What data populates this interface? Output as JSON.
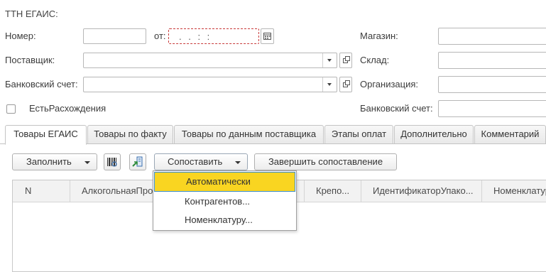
{
  "form": {
    "title": "ТТН ЕГАИС:"
  },
  "header": {
    "number_label": "Номер:",
    "number_value": "",
    "from_label": "от:",
    "date_value": ". .   : :",
    "supplier_label": "Поставщик:",
    "supplier_value": "",
    "bank_account_label": "Банковский счет:",
    "bank_account_value": "",
    "discrepancies_label": "ЕстьРасхождения",
    "store_label": "Магазин:",
    "warehouse_label": "Склад:",
    "organization_label": "Организация:",
    "org_bank_account_label": "Банковский счет:"
  },
  "tabs": [
    {
      "label": "Товары ЕГАИС"
    },
    {
      "label": "Товары по факту"
    },
    {
      "label": "Товары по данным поставщика"
    },
    {
      "label": "Этапы оплат"
    },
    {
      "label": "Дополнительно"
    },
    {
      "label": "Комментарий"
    }
  ],
  "toolbar": {
    "fill_label": "Заполнить",
    "match_label": "Сопоставить",
    "finish_match_label": "Завершить сопоставление",
    "barcode_icon": "barcode-icon",
    "import_icon": "import-icon"
  },
  "table": {
    "columns": [
      "N",
      "АлкогольнаяПро",
      "Крепо...",
      "ИдентификаторУпако...",
      "Номенклатура"
    ]
  },
  "match_menu": {
    "items": [
      "Автоматически",
      "Контрагентов...",
      "Номенклатуру..."
    ]
  },
  "colors": {
    "highlight": "#f9d521",
    "focus_border": "#3a8ed0",
    "date_field_border": "#c83a3a"
  }
}
